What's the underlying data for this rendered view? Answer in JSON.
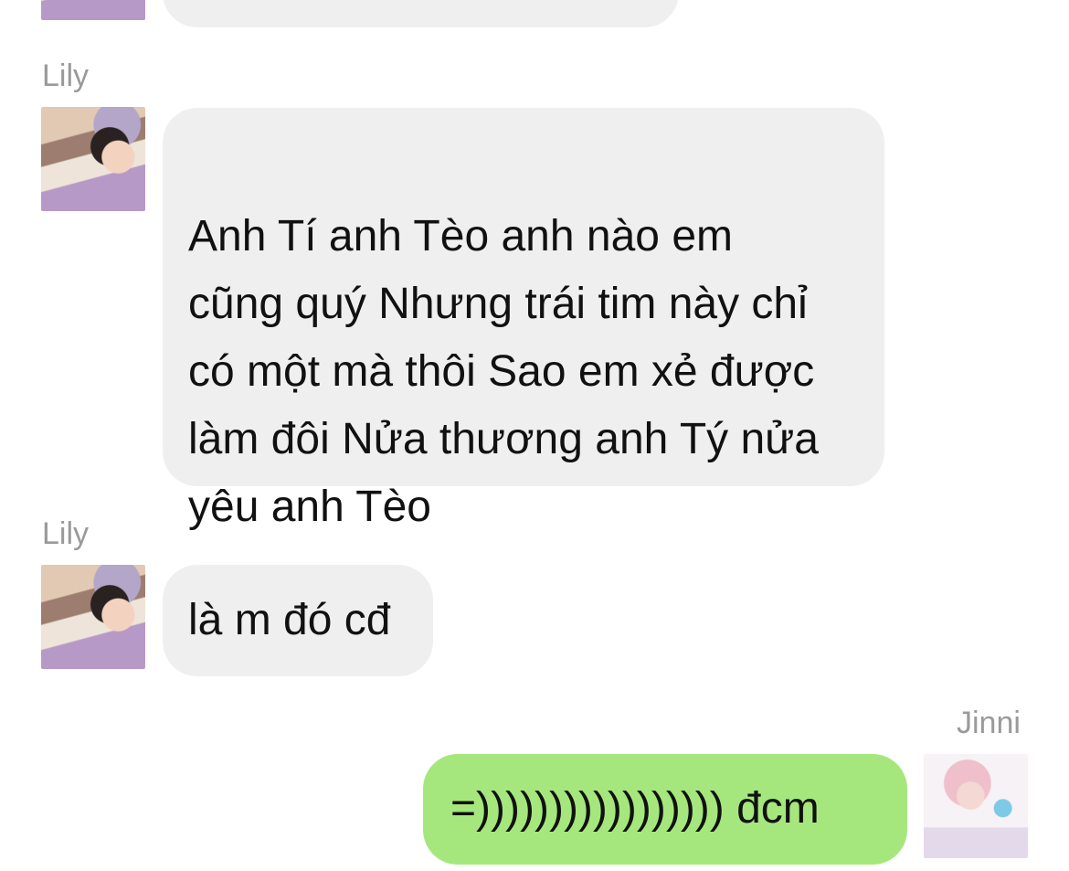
{
  "messages": {
    "lily_1": {
      "sender": "Lily",
      "text": "Anh Tí anh Tèo anh nào em\ncũng quý Nhưng trái tim này chỉ\ncó một mà thôi Sao em xẻ được\nlàm đôi Nửa thương anh Tý nửa\nyêu anh Tèo"
    },
    "lily_2": {
      "sender": "Lily",
      "text": "là m đó cđ"
    },
    "jinni_1": {
      "sender": "Jinni",
      "text": "=))))))))))))))))) đcm"
    }
  },
  "colors": {
    "incoming_bubble": "#efefef",
    "outgoing_bubble": "#a6e77d",
    "sender_name": "#9a9a9a",
    "message_text": "#111111"
  }
}
